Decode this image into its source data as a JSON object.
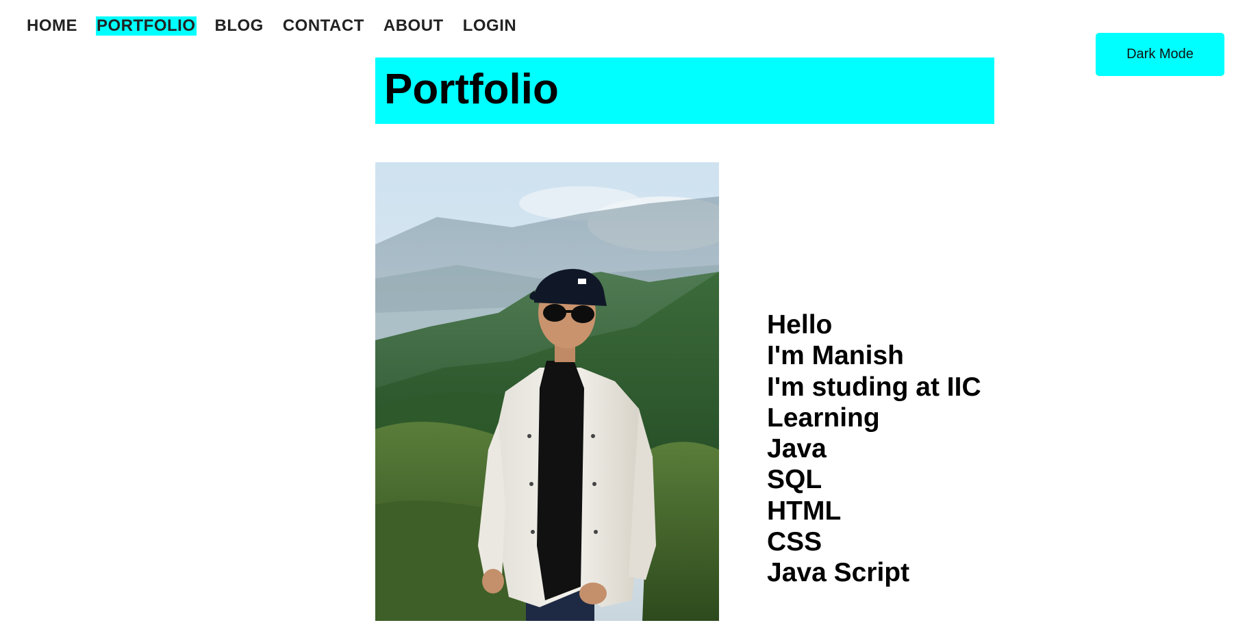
{
  "nav": {
    "items": [
      {
        "label": "HOME"
      },
      {
        "label": "PORTFOLIO"
      },
      {
        "label": "BLOG"
      },
      {
        "label": "CONTACT"
      },
      {
        "label": "ABOUT"
      },
      {
        "label": "LOGIN"
      }
    ],
    "active": "PORTFOLIO"
  },
  "dark_mode_button": {
    "label": "Dark Mode"
  },
  "header": {
    "title": "Portfolio"
  },
  "intro": {
    "lines": [
      "Hello",
      "I'm Manish",
      "I'm studing at IIC",
      "Learning",
      "Java",
      "SQL",
      "HTML",
      "CSS",
      "Java Script"
    ]
  },
  "colors": {
    "accent": "#00ffff",
    "text": "#000000",
    "nav_text": "#222222",
    "background": "#ffffff"
  }
}
